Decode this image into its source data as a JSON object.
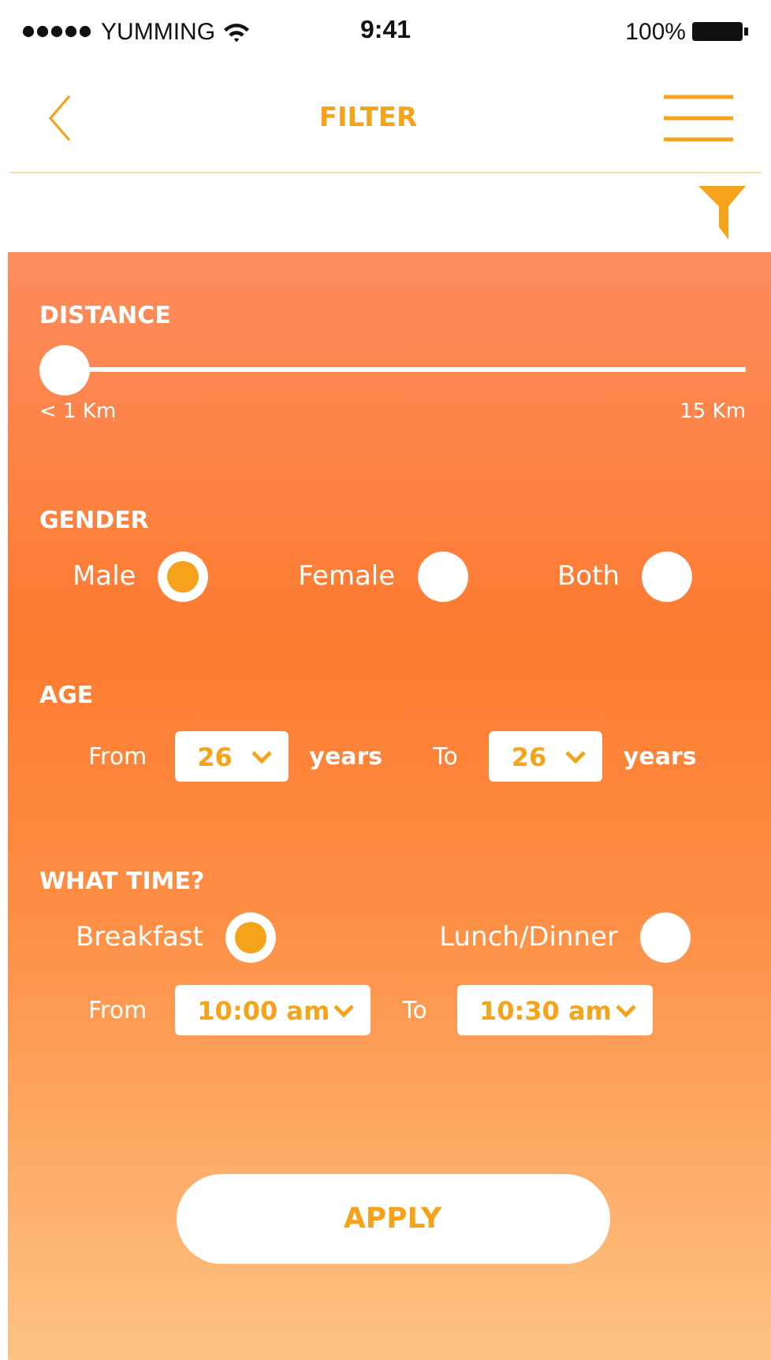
{
  "status_bar": {
    "carrier": "YUMMING",
    "time": "9:41",
    "battery": "100%"
  },
  "nav": {
    "title": "FILTER"
  },
  "distance": {
    "label": "DISTANCE",
    "level": 0,
    "min_label": "< 1 Km",
    "max_label": "15 Km"
  },
  "gender": {
    "label": "GENDER",
    "options": [
      {
        "label": "Male",
        "selected": true
      },
      {
        "label": "Female",
        "selected": false
      },
      {
        "label": "Both",
        "selected": false
      }
    ]
  },
  "age": {
    "label": "AGE",
    "from_label": "From",
    "from_value": "26",
    "from_unit": "years",
    "to_label": "To",
    "to_value": "26",
    "to_unit": "years"
  },
  "time": {
    "label": "WHAT TIME?",
    "options": [
      {
        "label": "Breakfast",
        "selected": true
      },
      {
        "label": "Lunch/Dinner",
        "selected": false
      }
    ],
    "from_label": "From",
    "from_value": "10:00 am",
    "to_label": "To",
    "to_value": "10:30 am"
  },
  "apply_button": "APPLY"
}
